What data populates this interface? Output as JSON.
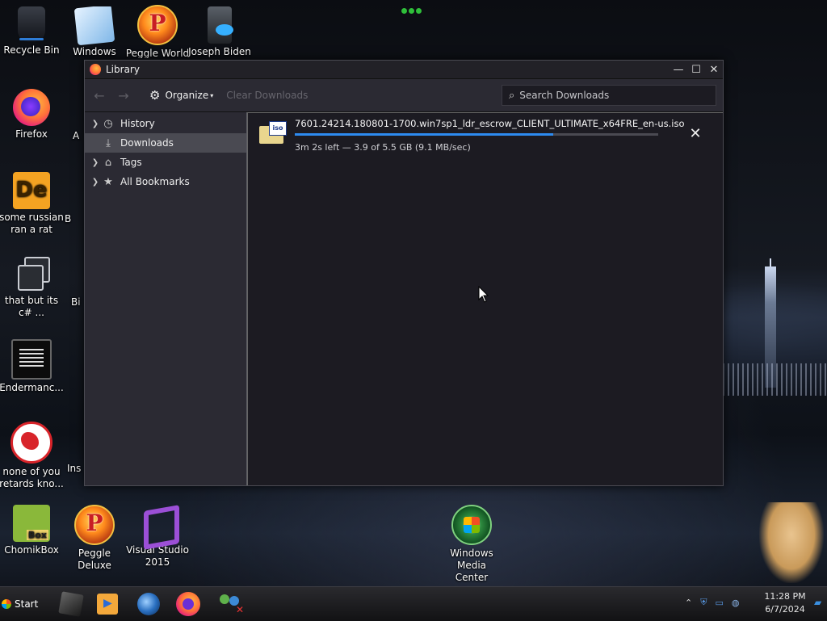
{
  "desktop": {
    "icons": [
      {
        "label": "Recycle Bin",
        "icon": "recycle-bin-icon"
      },
      {
        "label": "Windows Live",
        "icon": "windows-live-mail-icon"
      },
      {
        "label": "Peggle World",
        "icon": "peggle-icon"
      },
      {
        "label": "Joseph Biden",
        "icon": "computer-icon"
      },
      {
        "label": "Firefox",
        "icon": "firefox-icon"
      },
      {
        "label": "some russian ran a rat",
        "icon": "de-app-icon"
      },
      {
        "label": "that but its c# ...",
        "icon": "copy-icon"
      },
      {
        "label": "Endermanc...",
        "icon": "terminal-icon"
      },
      {
        "label": "none of you retards kno...",
        "icon": "dino-icon"
      },
      {
        "label": "ChomikBox",
        "icon": "chomikbox-icon"
      },
      {
        "label": "Peggle Deluxe",
        "icon": "peggle-icon"
      },
      {
        "label": "Visual Studio 2015",
        "icon": "visual-studio-icon"
      },
      {
        "label": "Windows Media Center",
        "icon": "windows-media-center-icon"
      }
    ],
    "partial_labels": [
      "B",
      "A",
      "B",
      "Bi",
      "Ins"
    ]
  },
  "window": {
    "title": "Library",
    "controls": {
      "minimize": "—",
      "maximize": "☐",
      "close": "✕"
    },
    "toolbar": {
      "back": "←",
      "forward": "→",
      "organize_label": "Organize",
      "clear_label": "Clear Downloads",
      "search_placeholder": "Search Downloads"
    },
    "sidebar": {
      "items": [
        {
          "label": "History",
          "icon": "clock-icon",
          "expandable": true
        },
        {
          "label": "Downloads",
          "icon": "download-icon",
          "expandable": false,
          "selected": true
        },
        {
          "label": "Tags",
          "icon": "tag-icon",
          "expandable": true
        },
        {
          "label": "All Bookmarks",
          "icon": "star-icon",
          "expandable": true
        }
      ]
    },
    "downloads": [
      {
        "filename": "7601.24214.180801-1700.win7sp1_ldr_escrow_CLIENT_ULTIMATE_x64FRE_en-us.iso",
        "file_badge": "iso",
        "status": "3m 2s left — 3.9 of 5.5 GB (9.1 MB/sec)",
        "progress": 0.71
      }
    ]
  },
  "taskbar": {
    "start_label": "Start",
    "pinned": [
      "cube-app-icon",
      "media-player-icon",
      "globe-icon",
      "firefox-icon",
      "people-icon"
    ],
    "tray_icons": [
      "chevron-up-icon",
      "shield-icon",
      "monitor-icon",
      "network-icon"
    ],
    "time": "11:28 PM",
    "date": "6/7/2024"
  },
  "colors": {
    "progress_fill": "#2d8bf0",
    "window_bg": "#1c1b22",
    "toolbar_bg": "#2b2a33",
    "selected_bg": "#4a4a52"
  }
}
